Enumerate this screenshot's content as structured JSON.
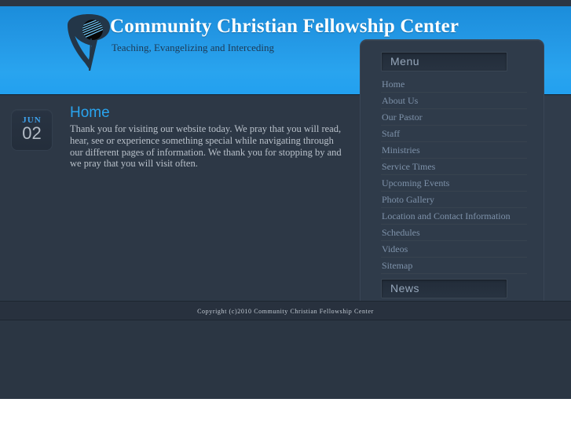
{
  "site": {
    "title": "Community Christian Fellowship Center",
    "tagline": "Teaching, Evangelizing and Interceding",
    "logo_icon": "swoosh-globe-logo"
  },
  "article": {
    "date_month": "JUN",
    "date_day": "02",
    "title": "Home",
    "body": "Thank you for visiting our website today.  We pray that you will read, hear, see or experience something special while navigating through our different pages of information.  We thank you for stopping by and we pray that you will visit often."
  },
  "sidebar": {
    "menu_heading": "Menu",
    "news_heading": "News",
    "menu_items": [
      {
        "label": "Home"
      },
      {
        "label": "About Us"
      },
      {
        "label": "Our Pastor"
      },
      {
        "label": "Staff"
      },
      {
        "label": "Ministries"
      },
      {
        "label": "Service Times"
      },
      {
        "label": "Upcoming Events"
      },
      {
        "label": "Photo Gallery"
      },
      {
        "label": "Location and Contact Information"
      },
      {
        "label": "Schedules"
      },
      {
        "label": "Videos"
      },
      {
        "label": "Sitemap"
      }
    ]
  },
  "footer": {
    "copyright": "Copyright (c)2010 Community Christian Fellowship Center"
  },
  "colors": {
    "header_blue": "#29a4ef",
    "body_dark": "#2b3643",
    "panel_dark": "#2f3b4a",
    "accent_link": "#29a4ef",
    "menu_text": "#7e92aa"
  }
}
